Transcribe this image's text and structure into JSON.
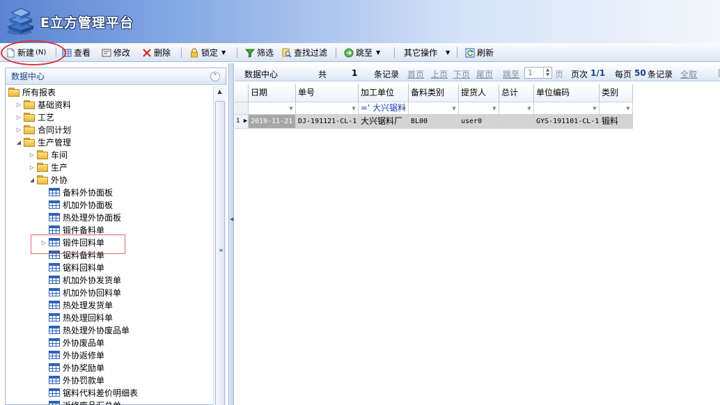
{
  "app": {
    "title": "E立方管理平台"
  },
  "toolbar": {
    "new_label": "新建",
    "new_shortcut": "(N)",
    "view_label": "查看",
    "edit_label": "修改",
    "delete_label": "删除",
    "lock_label": "锁定",
    "filter_label": "筛选",
    "find_filter_label": "查找过滤",
    "jump_label": "跳至",
    "other_label": "其它操作",
    "refresh_label": "刷新"
  },
  "left_panel": {
    "title": "数据中心",
    "tree": [
      {
        "label": "所有报表",
        "level": 0,
        "type": "folder",
        "expander": ""
      },
      {
        "label": "基础资料",
        "level": 1,
        "type": "folder",
        "expander": "▷"
      },
      {
        "label": "工艺",
        "level": 1,
        "type": "folder",
        "expander": "▷"
      },
      {
        "label": "合同计划",
        "level": 1,
        "type": "folder",
        "expander": "▷"
      },
      {
        "label": "生产管理",
        "level": 1,
        "type": "folder",
        "expander": "◢"
      },
      {
        "label": "车间",
        "level": 2,
        "type": "folder",
        "expander": "▷"
      },
      {
        "label": "生产",
        "level": 2,
        "type": "folder",
        "expander": "▷"
      },
      {
        "label": "外协",
        "level": 2,
        "type": "folder",
        "expander": "◢"
      },
      {
        "label": "备料外协面板",
        "level": 3,
        "type": "table",
        "expander": ""
      },
      {
        "label": "机加外协面板",
        "level": 3,
        "type": "table",
        "expander": ""
      },
      {
        "label": "热处理外协面板",
        "level": 3,
        "type": "table",
        "expander": ""
      },
      {
        "label": "锻件备料单",
        "level": 3,
        "type": "table",
        "expander": ""
      },
      {
        "label": "锻件回料单",
        "level": 3,
        "type": "table",
        "expander": "▷"
      },
      {
        "label": "锯料备料单",
        "level": 3,
        "type": "table",
        "expander": ""
      },
      {
        "label": "锯料回料单",
        "level": 3,
        "type": "table",
        "expander": ""
      },
      {
        "label": "机加外协发货单",
        "level": 3,
        "type": "table",
        "expander": ""
      },
      {
        "label": "机加外协回料单",
        "level": 3,
        "type": "table",
        "expander": ""
      },
      {
        "label": "热处理发货单",
        "level": 3,
        "type": "table",
        "expander": ""
      },
      {
        "label": "热处理回料单",
        "level": 3,
        "type": "table",
        "expander": ""
      },
      {
        "label": "热处理外协废品单",
        "level": 3,
        "type": "table",
        "expander": ""
      },
      {
        "label": "外协废品单",
        "level": 3,
        "type": "table",
        "expander": ""
      },
      {
        "label": "外协返修单",
        "level": 3,
        "type": "table",
        "expander": ""
      },
      {
        "label": "外协奖励单",
        "level": 3,
        "type": "table",
        "expander": ""
      },
      {
        "label": "外协罚款单",
        "level": 3,
        "type": "table",
        "expander": ""
      },
      {
        "label": "锯料代料差价明细表",
        "level": 3,
        "type": "table",
        "expander": ""
      },
      {
        "label": "返修废品汇总单",
        "level": 3,
        "type": "table",
        "expander": ""
      }
    ]
  },
  "right_panel": {
    "title": "数据中心",
    "total_prefix": "共",
    "total_count": "1",
    "total_suffix": "条记录",
    "first_page": "首页",
    "prev_page": "上页",
    "next_page": "下页",
    "last_page": "尾页",
    "jump_to": "跳至",
    "page_input": "1",
    "page_unit": "页",
    "page_info_prefix": "页次",
    "page_info": "1/1",
    "per_page_prefix": "每页",
    "per_page": "50",
    "per_page_suffix": "条记录",
    "select_all": "全取"
  },
  "grid": {
    "columns": [
      "日期",
      "单号",
      "加工单位",
      "备料类别",
      "提货人",
      "总计",
      "单位编码",
      "类别"
    ],
    "filter_values": [
      "",
      "",
      "=' 大兴锯料",
      "",
      "",
      "",
      "",
      ""
    ],
    "rows": [
      {
        "num": "1",
        "cells": [
          "2019-11-21",
          "DJ-191121-CL-1",
          "大兴锯料厂",
          "BL00",
          "user0",
          "",
          "GYS-191101-CL-1",
          "锻料"
        ]
      }
    ]
  }
}
